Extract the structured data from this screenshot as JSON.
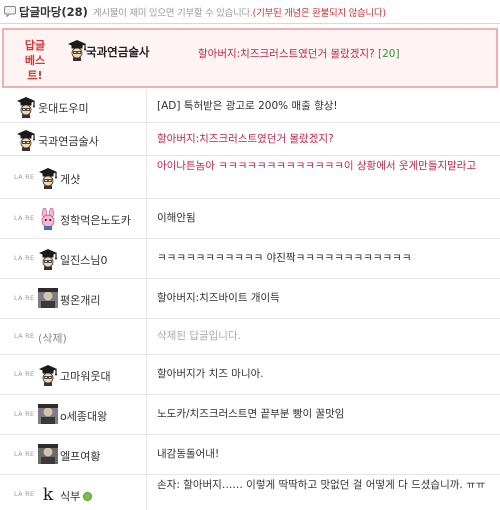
{
  "header": {
    "title": "답글마당",
    "count": "(28)",
    "notice": "게시물이 재미 있으면 기부할 수 있습니다.",
    "notice_refund": "(기부된 개념은 환불되지 않습니다)"
  },
  "best": {
    "label_line1": "답글",
    "label_line2": "베스트!",
    "nickname": "국과연금술사",
    "text": "할아버지:치즈크러스트였던거 몰랐겠지?",
    "count": "[20]"
  },
  "reply_tag": "LA RE",
  "comments": [
    {
      "nickname": "웃대도우미",
      "avatar": "graduate-avatar",
      "is_reply": false,
      "text": "[AD] 특허받은 광고로 200% 매출 향상!",
      "style": "normal"
    },
    {
      "nickname": "국과연금술사",
      "avatar": "graduate-avatar",
      "is_reply": false,
      "text": "할아버지:치즈크러스트였던거 몰랐겠지?",
      "style": "red"
    },
    {
      "nickname": "게샷",
      "avatar": "graduate-avatar",
      "is_reply": true,
      "text": "아이나튼놈아 ㅋㅋㅋㅋㅋㅋㅋㅋㅋㅋㅋㅋㅋ이 상황에서 웃게만들지말라고",
      "style": "red"
    },
    {
      "nickname": "정학먹은노도카",
      "avatar": "bunny-avatar",
      "is_reply": true,
      "text": "이해안됨",
      "style": "normal"
    },
    {
      "nickname": "일진스님0",
      "avatar": "graduate-avatar",
      "is_reply": true,
      "text": "ㅋㅋㅋㅋㅋㅋㅋㅋㅋㅋㅋ 야진짝ㅋㅋㅋㅋㅋㅋㅋㅋㅋㅋㅋㅋ",
      "style": "normal"
    },
    {
      "nickname": "평온개리",
      "avatar": "photo-avatar",
      "is_reply": true,
      "text": "할아버지:치즈바이트 개이득",
      "style": "normal"
    },
    {
      "nickname": "(삭제)",
      "avatar": "",
      "is_reply": true,
      "text": "삭제된 답글입니다.",
      "style": "deleted"
    },
    {
      "nickname": "고마워웃대",
      "avatar": "graduate-avatar",
      "is_reply": true,
      "text": "할아버지가 치즈 마니아.",
      "style": "normal"
    },
    {
      "nickname": "o세종대왕",
      "avatar": "photo-avatar",
      "is_reply": true,
      "text": "노도카/치즈크러스트면 끝부분 빵이 꿀맛임",
      "style": "normal"
    },
    {
      "nickname": "엘프여황",
      "avatar": "photo-avatar",
      "is_reply": true,
      "text": "내감동돌어내!",
      "style": "normal"
    },
    {
      "nickname": "식부",
      "avatar": "k-avatar",
      "is_reply": true,
      "online": true,
      "text": "손자: 할아버지…… 이렇게 딱딱하고 맛없던 걸 어떻게 다 드셨습니까. ㅠㅠ",
      "style": "normal"
    }
  ]
}
